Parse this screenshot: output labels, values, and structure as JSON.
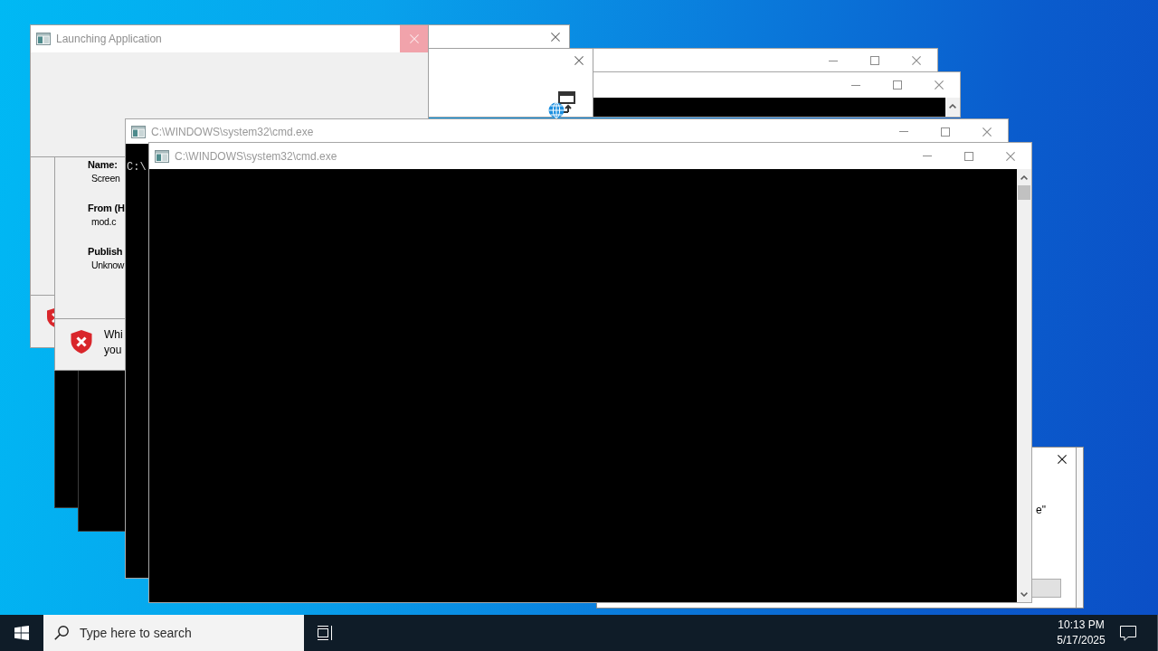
{
  "windows": [
    {
      "kind": "launcher",
      "title": "Launching Application",
      "close_hovered": true
    },
    {
      "kind": "dialog"
    },
    {
      "kind": "console"
    },
    {
      "kind": "console"
    },
    {
      "kind": "installer"
    },
    {
      "kind": "terminal"
    },
    {
      "kind": "terminal"
    },
    {
      "kind": "security",
      "fields": [
        {
          "label": "Name:",
          "value": "Screen"
        },
        {
          "label": "From (H",
          "value": "mod.c"
        },
        {
          "label": "Publish",
          "value": "Unknow"
        }
      ],
      "warning_lines": [
        "Whi",
        "you"
      ]
    },
    {
      "kind": "console",
      "title": "C:\\WINDOWS\\system32\\cmd.exe",
      "lines": [
        "C:\\"
      ]
    },
    {
      "kind": "message",
      "text": "e\""
    },
    {
      "kind": "console",
      "title": "C:\\WINDOWS\\system32\\cmd.exe"
    }
  ],
  "taskbar": {
    "search": {
      "placeholder": "Type here to search"
    },
    "clock": {
      "time": "10:13 PM",
      "date": "5/17/2025"
    }
  }
}
